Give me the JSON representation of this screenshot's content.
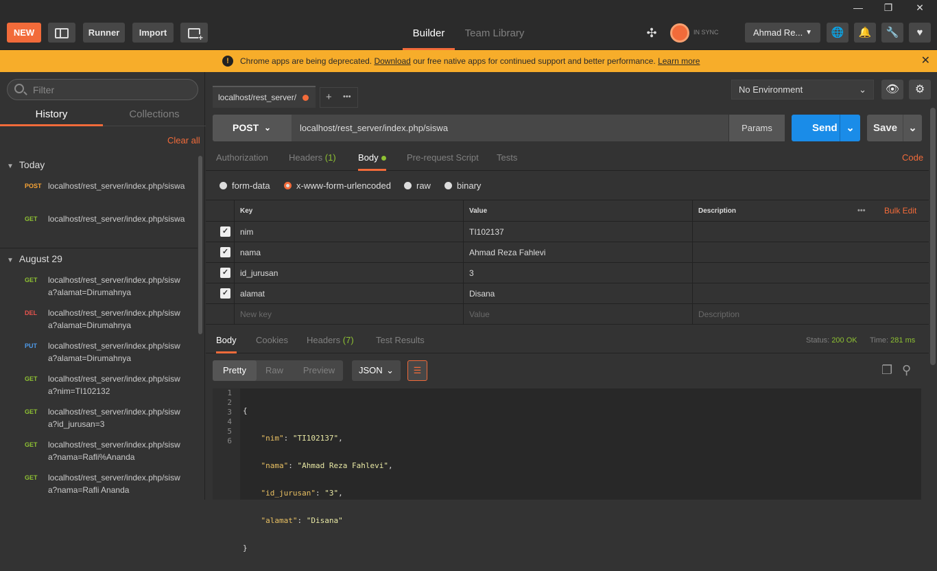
{
  "window": {
    "minimize": "—",
    "restore": "❐",
    "close": "✕"
  },
  "topbar": {
    "new_label": "NEW",
    "runner_label": "Runner",
    "import_label": "Import",
    "builder_tab": "Builder",
    "team_library_tab": "Team Library",
    "sync_status": "IN SYNC",
    "user_name": "Ahmad Re..."
  },
  "banner": {
    "msg_start": "Chrome apps are being deprecated. ",
    "download": "Download",
    "msg_mid": " our free native apps for continued support and better performance. ",
    "learn_more": "Learn more",
    "close": "✕"
  },
  "sidebar": {
    "filter_placeholder": "Filter",
    "history_tab": "History",
    "collections_tab": "Collections",
    "clear_all": "Clear all",
    "groups": [
      {
        "label": "Today",
        "items": [
          {
            "method": "POST",
            "url": "localhost/rest_server/index.php/siswa"
          },
          {
            "method": "GET",
            "url": "localhost/rest_server/index.php/siswa"
          }
        ]
      },
      {
        "label": "August 29",
        "items": [
          {
            "method": "GET",
            "url": "localhost/rest_server/index.php/siswa?alamat=Dirumahnya"
          },
          {
            "method": "DEL",
            "url": "localhost/rest_server/index.php/siswa?alamat=Dirumahnya"
          },
          {
            "method": "PUT",
            "url": "localhost/rest_server/index.php/siswa?alamat=Dirumahnya"
          },
          {
            "method": "GET",
            "url": "localhost/rest_server/index.php/siswa?nim=TI102132"
          },
          {
            "method": "GET",
            "url": "localhost/rest_server/index.php/siswa?id_jurusan=3"
          },
          {
            "method": "GET",
            "url": "localhost/rest_server/index.php/siswa?nama=Rafli%Ananda"
          },
          {
            "method": "GET",
            "url": "localhost/rest_server/index.php/siswa?nama=Rafli Ananda"
          }
        ]
      }
    ]
  },
  "request": {
    "tab_label": "localhost/rest_server/",
    "environment": "No Environment",
    "method": "POST",
    "url": "localhost/rest_server/index.php/siswa",
    "params_label": "Params",
    "send_label": "Send",
    "save_label": "Save",
    "tabs": {
      "authorization": "Authorization",
      "headers": "Headers",
      "headers_count": "(1)",
      "body": "Body",
      "prerequest": "Pre-request Script",
      "tests": "Tests",
      "code": "Code"
    },
    "body_modes": {
      "form_data": "form-data",
      "urlencoded": "x-www-form-urlencoded",
      "raw": "raw",
      "binary": "binary"
    },
    "table": {
      "headers": {
        "key": "Key",
        "value": "Value",
        "description": "Description",
        "more": "•••",
        "bulk_edit": "Bulk Edit"
      },
      "rows": [
        {
          "key": "nim",
          "value": "TI102137"
        },
        {
          "key": "nama",
          "value": "Ahmad Reza Fahlevi"
        },
        {
          "key": "id_jurusan",
          "value": "3"
        },
        {
          "key": "alamat",
          "value": "Disana"
        }
      ],
      "placeholders": {
        "key": "New key",
        "value": "Value",
        "description": "Description"
      }
    }
  },
  "response": {
    "tabs": {
      "body": "Body",
      "cookies": "Cookies",
      "headers": "Headers",
      "headers_count": "(7)",
      "test_results": "Test Results"
    },
    "status_label": "Status:",
    "status_value": "200 OK",
    "time_label": "Time:",
    "time_value": "281 ms",
    "formats": {
      "pretty": "Pretty",
      "raw": "Raw",
      "preview": "Preview"
    },
    "language": "JSON",
    "lines": [
      "1",
      "2",
      "3",
      "4",
      "5",
      "6"
    ],
    "json": {
      "open": "{",
      "close": "}",
      "k1": "\"nim\"",
      "v1": "\"TI102137\"",
      "k2": "\"nama\"",
      "v2": "\"Ahmad Reza Fahlevi\"",
      "k3": "\"id_jurusan\"",
      "v3": "\"3\"",
      "k4": "\"alamat\"",
      "v4": "\"Disana\""
    }
  }
}
